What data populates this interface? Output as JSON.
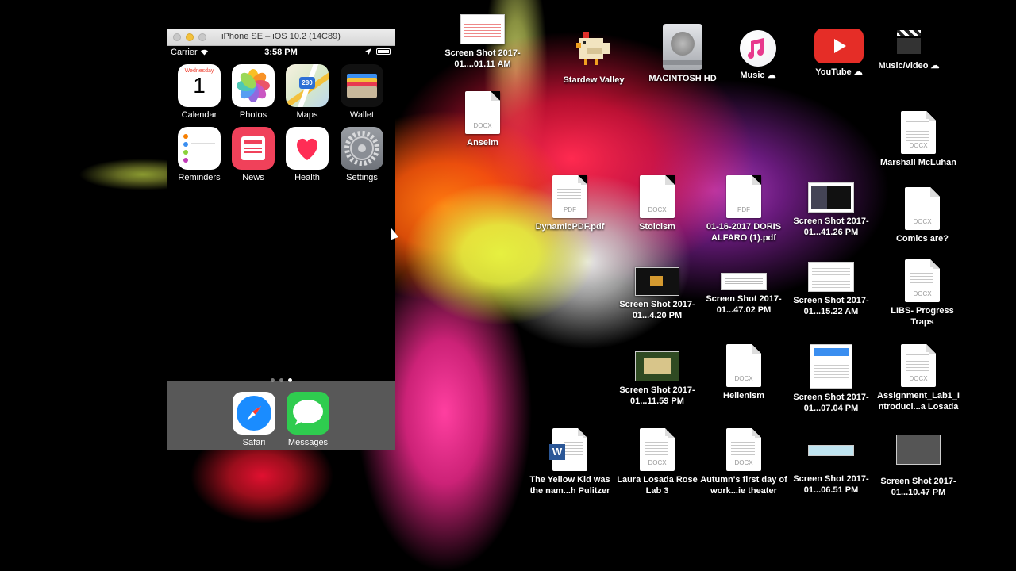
{
  "simulator": {
    "title": "iPhone SE – iOS 10.2 (14C89)",
    "status": {
      "carrier": "Carrier",
      "time": "3:58 PM"
    },
    "apps": [
      {
        "name": "calendar",
        "label": "Calendar",
        "weekday": "Wednesday",
        "day": "1"
      },
      {
        "name": "photos",
        "label": "Photos"
      },
      {
        "name": "maps",
        "label": "Maps",
        "route": "280"
      },
      {
        "name": "wallet",
        "label": "Wallet"
      },
      {
        "name": "reminders",
        "label": "Reminders"
      },
      {
        "name": "news",
        "label": "News"
      },
      {
        "name": "health",
        "label": "Health"
      },
      {
        "name": "settings",
        "label": "Settings"
      }
    ],
    "dock": [
      {
        "name": "safari",
        "label": "Safari"
      },
      {
        "name": "messages",
        "label": "Messages"
      }
    ],
    "page_count": 3,
    "active_page": 3
  },
  "desktop": {
    "items": [
      {
        "label": "Screen Shot 2017-01....01.11 AM",
        "kind": "screenshot"
      },
      {
        "label": "Anselm",
        "kind": "doc",
        "ext": "DOCX"
      },
      {
        "label": "Stardew Valley",
        "kind": "app"
      },
      {
        "label": "MACINTOSH HD",
        "kind": "disk"
      },
      {
        "label": "Music",
        "kind": "folder-music"
      },
      {
        "label": "YouTube",
        "kind": "folder-youtube"
      },
      {
        "label": "Music/video",
        "kind": "folder-clapper"
      },
      {
        "label": "Marshall McLuhan",
        "kind": "doc",
        "ext": "DOCX"
      },
      {
        "label": "DynamicPDF.pdf",
        "kind": "doc",
        "ext": "PDF"
      },
      {
        "label": "Stoicism",
        "kind": "doc",
        "ext": "DOCX"
      },
      {
        "label": "01-16-2017 DORIS ALFARO (1).pdf",
        "kind": "doc",
        "ext": "PDF"
      },
      {
        "label": "Screen Shot 2017-01...41.26 PM",
        "kind": "screenshot"
      },
      {
        "label": "Comics are?",
        "kind": "doc",
        "ext": "DOCX"
      },
      {
        "label": "Screen Shot 2017-01...4.20 PM",
        "kind": "screenshot"
      },
      {
        "label": "Screen Shot 2017-01...47.02 PM",
        "kind": "screenshot"
      },
      {
        "label": "Screen Shot 2017-01...15.22 AM",
        "kind": "screenshot"
      },
      {
        "label": "LIBS- Progress Traps",
        "kind": "doc",
        "ext": "DOCX"
      },
      {
        "label": "Screen Shot 2017-01...11.59 PM",
        "kind": "screenshot"
      },
      {
        "label": "Hellenism",
        "kind": "doc",
        "ext": "DOCX"
      },
      {
        "label": "Screen Shot 2017-01...07.04 PM",
        "kind": "screenshot"
      },
      {
        "label": "Assignment_Lab1_I ntroduci...a Losada",
        "kind": "doc",
        "ext": "DOCX"
      },
      {
        "label": "The Yellow Kid was the nam...h Pulitzer",
        "kind": "word"
      },
      {
        "label": "Laura Losada Rose Lab 3",
        "kind": "doc",
        "ext": "DOCX"
      },
      {
        "label": "Autumn's first day of work...ie theater",
        "kind": "doc",
        "ext": "DOCX"
      },
      {
        "label": "Screen Shot 2017-01...06.51 PM",
        "kind": "screenshot"
      },
      {
        "label": "Screen Shot 2017-01...10.47 PM",
        "kind": "screenshot"
      }
    ]
  },
  "colors": {
    "dock": "#9a9a9a",
    "youtube": "#e52d27",
    "news": "#f0415a",
    "health_heart": "#ff2d55",
    "messages": "#2fcc4f",
    "safari": "#1a8cff"
  }
}
